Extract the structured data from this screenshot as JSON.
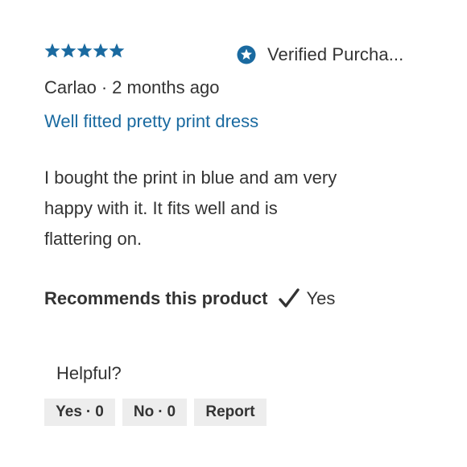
{
  "review": {
    "rating": 5,
    "rating_max": 5,
    "star_color": "#1a6aa0",
    "verified": {
      "icon": "verified-star-badge-icon",
      "label": "Verified Purcha..."
    },
    "author": "Carlao",
    "separator": "·",
    "time_ago": "2 months ago",
    "title": "Well fitted pretty print dress",
    "title_color": "#1a6aa0",
    "body_lines": [
      "I bought the print in blue and am very",
      "happy with it. It fits well and is",
      "flattering on."
    ],
    "recommends": {
      "label": "Recommends this product",
      "icon": "checkmark-icon",
      "value": "Yes"
    },
    "helpful": {
      "label": "Helpful?",
      "yes_label": "Yes",
      "yes_count": "0",
      "no_label": "No",
      "no_count": "0",
      "report_label": "Report",
      "separator": "·"
    }
  }
}
